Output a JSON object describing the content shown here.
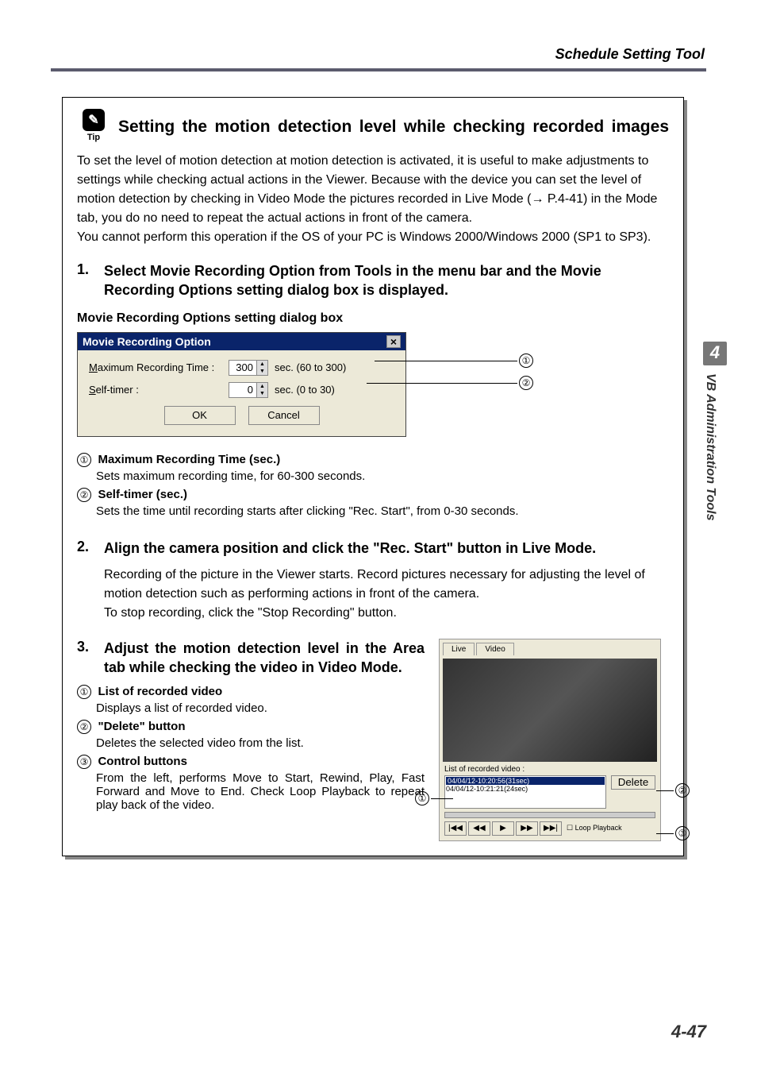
{
  "header": {
    "title": "Schedule Setting Tool"
  },
  "sidebar": {
    "chapter": "4",
    "label": "VB Administration Tools"
  },
  "tip": {
    "icon_label": "Tip",
    "title": "Setting the motion detection level while checking recorded images",
    "body": "To set the level of motion detection at motion detection is activated, it is useful to make adjustments to settings while checking actual actions in the Viewer. Because with the device you can set the level of motion detection by checking in Video Mode the pictures recorded in Live Mode (→ P.4-41) in the Mode tab, you do no need to repeat the actual actions in front of the camera.\nYou cannot perform this operation if the OS of your PC is Windows 2000/Windows 2000 (SP1 to SP3)."
  },
  "step1": {
    "num": "1.",
    "title": "Select Movie Recording Option from Tools in the menu bar and the Movie Recording Options setting dialog box is displayed.",
    "subhead": "Movie Recording Options setting dialog box"
  },
  "dialog": {
    "title": "Movie Recording Option",
    "row1_label_u": "M",
    "row1_label_rest": "aximum Recording Time :",
    "row1_value": "300",
    "row1_range": "sec. (60 to 300)",
    "row2_label_u": "S",
    "row2_label_rest": "elf-timer :",
    "row2_value": "0",
    "row2_range": "sec. (0 to 30)",
    "ok": "OK",
    "cancel": "Cancel"
  },
  "callouts1": {
    "one": "①",
    "two": "②"
  },
  "desc1": {
    "i1_t": "Maximum Recording Time (sec.)",
    "i1_d": "Sets maximum recording time, for 60-300 seconds.",
    "i2_t": "Self-timer (sec.)",
    "i2_d": "Sets the time until recording starts after clicking \"Rec. Start\", from 0-30 seconds."
  },
  "step2": {
    "num": "2.",
    "title": "Align the camera position and click the \"Rec. Start\" button in Live Mode.",
    "body": "Recording of the picture in the Viewer starts. Record pictures necessary for adjusting the level of motion detection such as performing actions in front of the camera.\nTo stop recording, click the \"Stop Recording\" button."
  },
  "step3": {
    "num": "3.",
    "title": "Adjust the motion detection level in the Area tab while checking the video in Video Mode."
  },
  "desc3": {
    "i1_t": "List of recorded video",
    "i1_d": "Displays a list of recorded video.",
    "i2_t": "\"Delete\" button",
    "i2_d": "Deletes the selected video from the list.",
    "i3_t": "Control buttons",
    "i3_d": "From the left, performs Move to Start, Rewind, Play, Fast Forward and Move to End. Check Loop Playback to repeat play back of the video."
  },
  "video_dialog": {
    "tab1": "Live",
    "tab2": "Video",
    "list_label": "List of recorded video :",
    "entry_sel": "04/04/12-10:20:56(31sec)",
    "entry2": "04/04/12-10:21:21(24sec)",
    "delete": "Delete",
    "loop": "Loop Playback"
  },
  "callouts3": {
    "one": "①",
    "two": "②",
    "three": "③"
  },
  "footer": {
    "page": "4-47"
  }
}
